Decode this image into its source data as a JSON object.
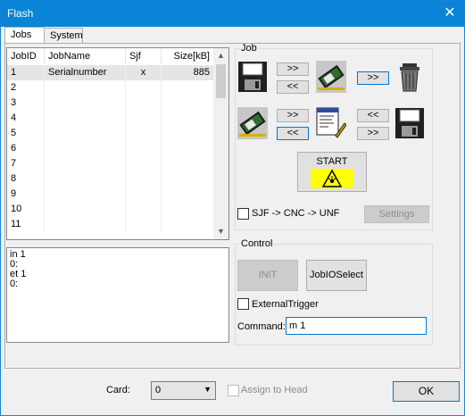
{
  "window": {
    "title": "Flash",
    "close_label": "✕"
  },
  "tabs": [
    {
      "label": "Jobs",
      "active": true
    },
    {
      "label": "System",
      "active": false
    }
  ],
  "jobs_table": {
    "columns": [
      "JobID",
      "JobName",
      "Sjf",
      "Size[kB]"
    ],
    "rows": [
      [
        "1",
        "Serialnumber",
        "x",
        "885"
      ],
      [
        "2",
        "",
        "",
        ""
      ],
      [
        "3",
        "",
        "",
        ""
      ],
      [
        "4",
        "",
        "",
        ""
      ],
      [
        "5",
        "",
        "",
        ""
      ],
      [
        "6",
        "",
        "",
        ""
      ],
      [
        "7",
        "",
        "",
        ""
      ],
      [
        "8",
        "",
        "",
        ""
      ],
      [
        "9",
        "",
        "",
        ""
      ],
      [
        "10",
        "",
        "",
        ""
      ],
      [
        "11",
        "",
        "",
        ""
      ]
    ]
  },
  "log": {
    "lines": [
      "in 1",
      "0:",
      "et 1",
      "0:"
    ]
  },
  "job_group": {
    "legend": "Job",
    "save_to_card": ">>",
    "load_from_card": "<<",
    "delete_arrow": ">>",
    "edit_to_card": ">>",
    "card_to_edit": "<<",
    "edit_to_disk": "<<",
    "disk_to_edit": ">>",
    "start_label": "START",
    "sjf_label": "SJF -> CNC -> UNF",
    "settings_label": "Settings"
  },
  "control_group": {
    "legend": "Control",
    "init_label": "INIT",
    "jobio_label": "JobIOSelect",
    "external_trigger_label": "ExternalTrigger",
    "command_label": "Command:",
    "command_value": "m 1"
  },
  "footer": {
    "card_label": "Card:",
    "card_value": "0",
    "assign_label": "Assign to Head",
    "ok_label": "OK"
  },
  "icons": {
    "floppy": "floppy-disk-icon",
    "chip": "memory-chip-icon",
    "trash": "trash-can-icon",
    "editor": "document-editor-icon",
    "warning": "laser-warning-icon"
  },
  "colors": {
    "title_bar": "#0a84d6",
    "start_bg": "#ffff00",
    "focus": "#0078d7"
  }
}
